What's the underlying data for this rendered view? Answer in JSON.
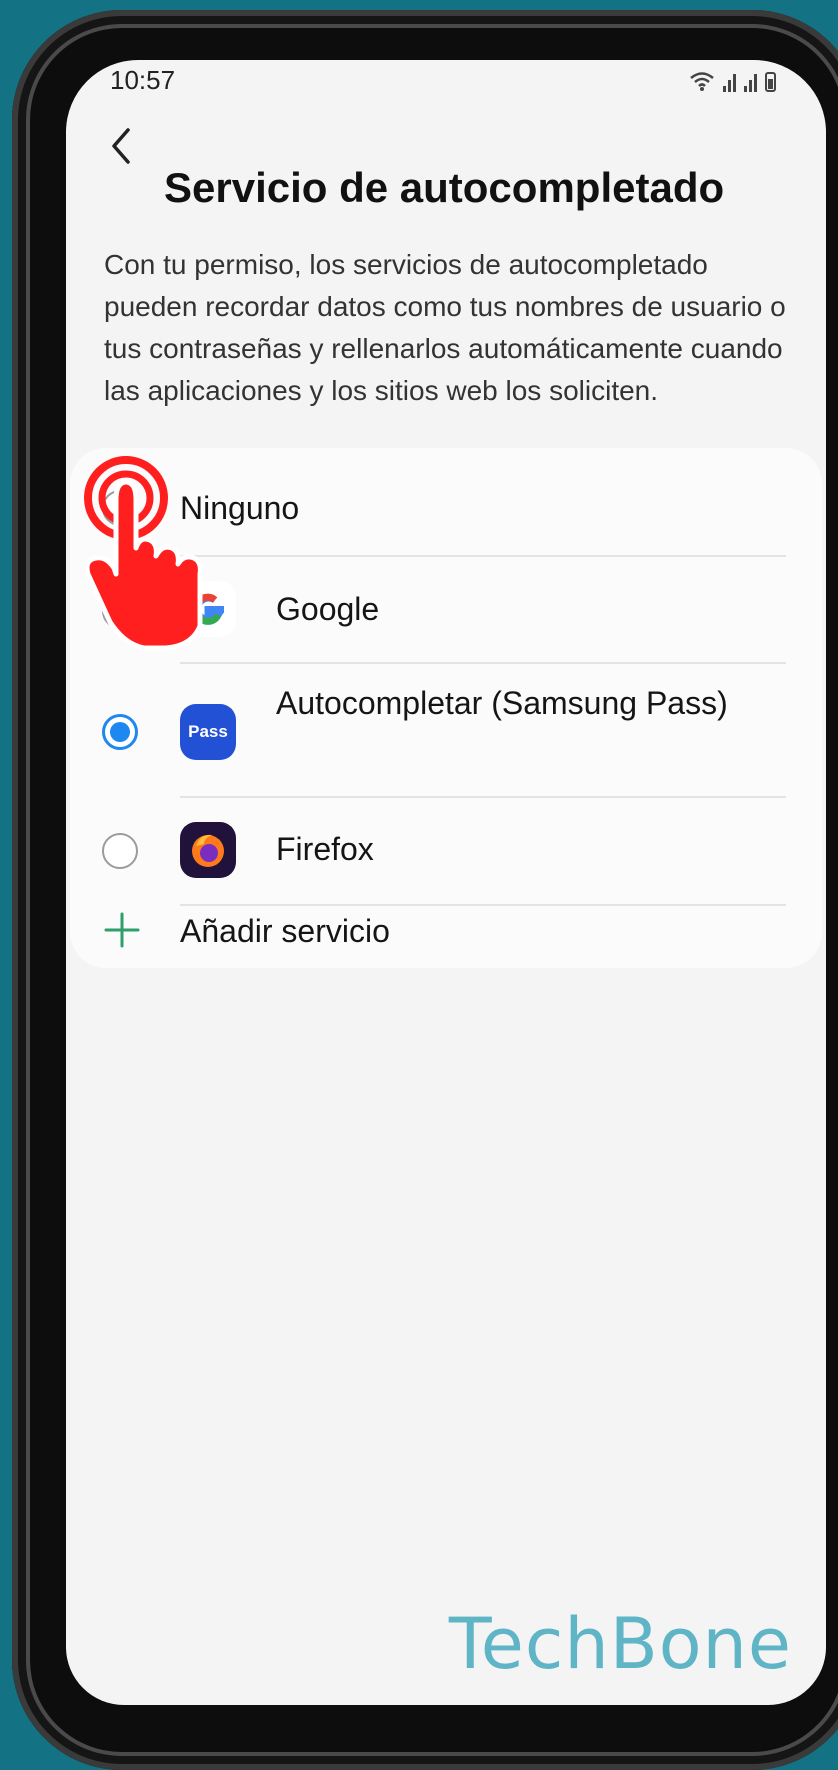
{
  "status_bar": {
    "time": "10:57",
    "icons": [
      "wifi-icon",
      "signal-icon",
      "signal-icon",
      "battery-icon"
    ]
  },
  "header": {
    "title": "Servicio de autocompletado",
    "back_icon": "chevron-left-icon"
  },
  "description": "Con tu permiso, los servicios de autocompletado pueden recordar datos como tus nombres de usuario o tus contraseñas y rellenarlos automáticamente cuando las aplicaciones y los sitios web los soliciten.",
  "options": [
    {
      "label": "Ninguno",
      "selected": false
    },
    {
      "label": "Google",
      "icon": "google-icon",
      "selected": false
    },
    {
      "label": "Autocompletar (Samsung Pass)",
      "icon": "samsung-pass-icon",
      "icon_text": "Pass",
      "selected": true
    },
    {
      "label": "Firefox",
      "icon": "firefox-icon",
      "selected": false
    }
  ],
  "add_service": {
    "label": "Añadir servicio",
    "icon": "plus-icon"
  },
  "overlay": {
    "icon": "tap-hand-icon"
  },
  "watermark": "TechBone",
  "colors": {
    "accent": "#1e88f0",
    "add_plus": "#2e9e6a",
    "hand": "#ff1f1f",
    "background": "#137384"
  }
}
